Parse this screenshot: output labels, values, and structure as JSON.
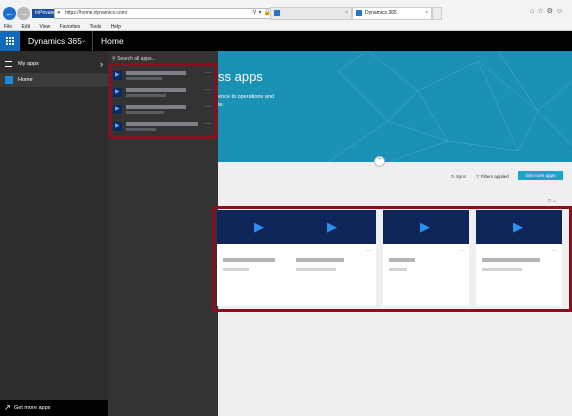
{
  "browser": {
    "inprivate": "InPrivate",
    "url": "https://home.dynamics.com/",
    "tab_active_title": "Dynamics 365",
    "menu": [
      "File",
      "Edit",
      "View",
      "Favorites",
      "Tools",
      "Help"
    ]
  },
  "appbar": {
    "app_name": "Dynamics 365",
    "breadcrumb": "Home"
  },
  "leftnav": {
    "items": [
      {
        "label": "My apps",
        "icon": "list-icon"
      },
      {
        "label": "Home",
        "icon": "home-icon"
      }
    ],
    "get_more": "Get more apps"
  },
  "flyout": {
    "search_placeholder": "Search all apps...",
    "apps_count_visible": 4
  },
  "hero": {
    "title": "ss apps",
    "subtitle": "ence to operations and\nte."
  },
  "toolbar": {
    "sync": "Sync",
    "filters": "Filters applied",
    "get_more": "Get more apps"
  },
  "cards_count_visible": 4,
  "colors": {
    "brand_blue": "#0f6cbd",
    "hero_teal": "#1a91b5",
    "card_band": "#0f2459",
    "highlight": "#8b0e1f",
    "cta": "#1ea4c9"
  }
}
